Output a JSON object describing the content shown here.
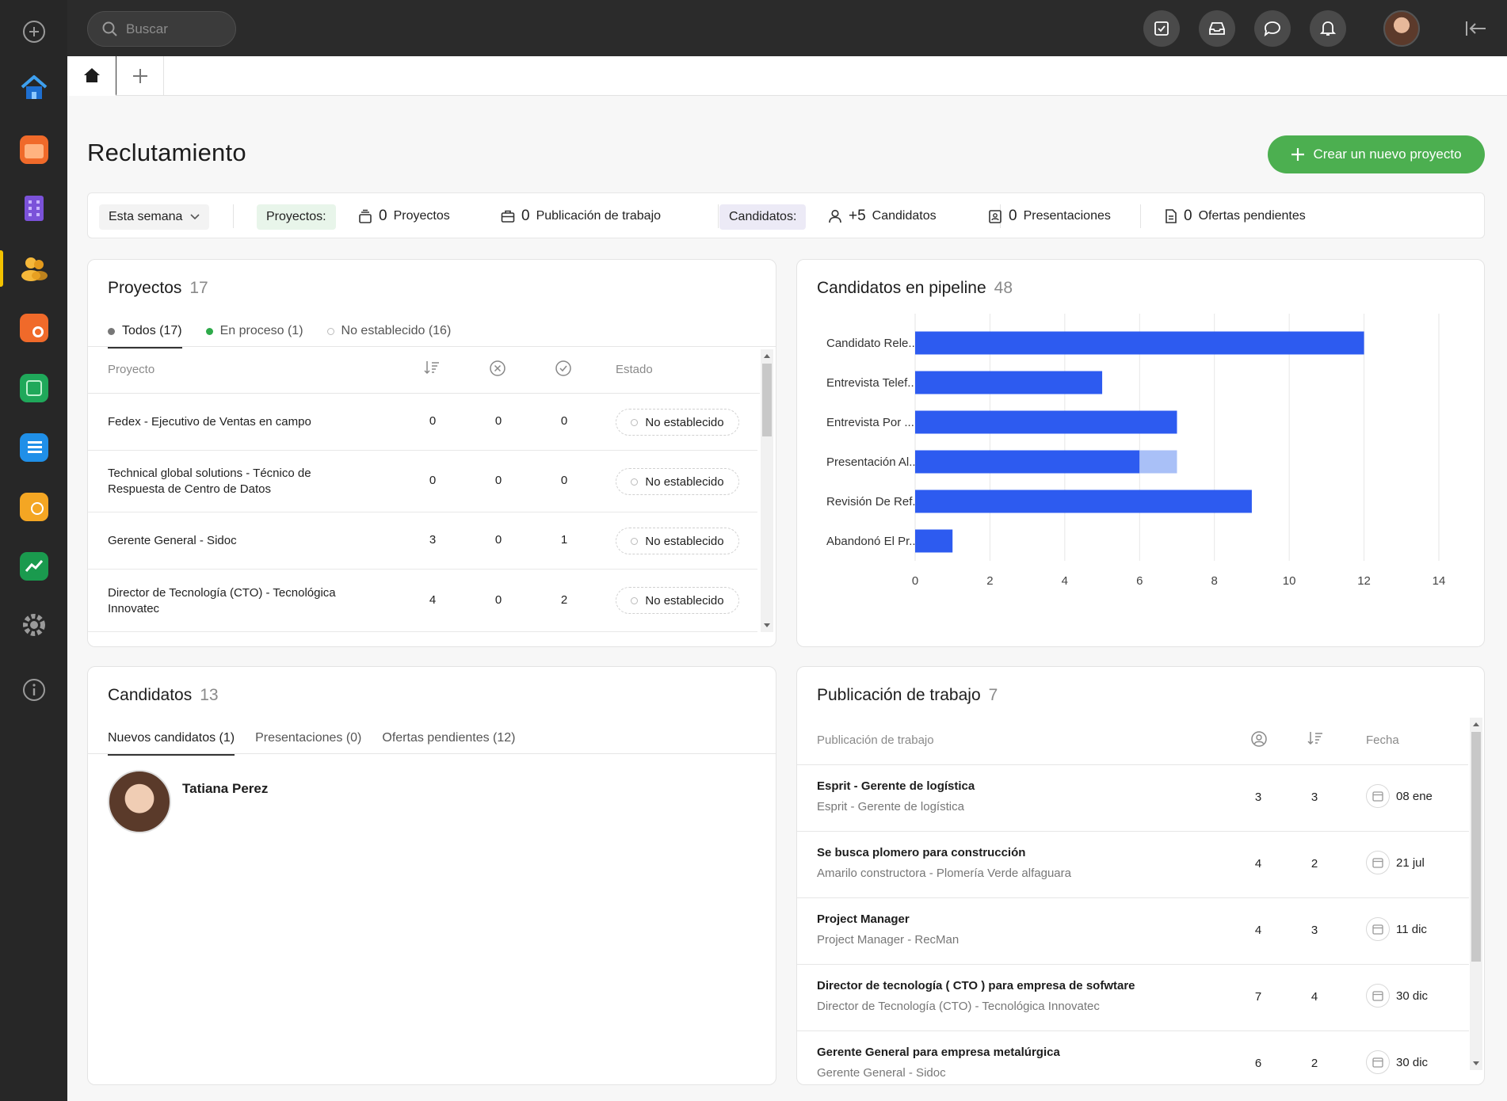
{
  "search": {
    "placeholder": "Buscar"
  },
  "tabs": {
    "home": "home-icon",
    "add": "plus-icon"
  },
  "page": {
    "title": "Reclutamiento",
    "new_project_label": "Crear un nuevo proyecto"
  },
  "filters": {
    "period": "Esta semana",
    "projects_label": "Proyectos:",
    "projects_count": "0",
    "projects_text": "Proyectos",
    "jobposts_count": "0",
    "jobposts_text": "Publicación de trabajo",
    "candidates_label": "Candidatos:",
    "candidates_count": "+5",
    "candidates_text": "Candidatos",
    "presentations_count": "0",
    "presentations_text": "Presentaciones",
    "offers_count": "0",
    "offers_text": "Ofertas pendientes"
  },
  "projects": {
    "title": "Proyectos",
    "count": "17",
    "tabs": [
      {
        "label": "Todos (17)",
        "color": "#777777"
      },
      {
        "label": "En proceso (1)",
        "color": "#2eaa4a"
      },
      {
        "label": "No establecido (16)",
        "color": "#ffffff"
      }
    ],
    "columns": {
      "project": "Proyecto",
      "state": "Estado"
    },
    "rows": [
      {
        "name": "Fedex - Ejecutivo de Ventas en campo",
        "a": "0",
        "b": "0",
        "c": "0",
        "state": "No establecido"
      },
      {
        "name": "Technical global solutions - Técnico de Respuesta de Centro de Datos",
        "a": "0",
        "b": "0",
        "c": "0",
        "state": "No establecido"
      },
      {
        "name": "Gerente General - Sidoc",
        "a": "3",
        "b": "0",
        "c": "1",
        "state": "No establecido"
      },
      {
        "name": "Director de Tecnología (CTO) - Tecnológica Innovatec",
        "a": "4",
        "b": "0",
        "c": "2",
        "state": "No establecido"
      }
    ]
  },
  "pipeline": {
    "title": "Candidatos en pipeline",
    "count": "48"
  },
  "chart_data": {
    "type": "bar",
    "orientation": "horizontal",
    "categories": [
      "Candidato Rele...",
      "Entrevista Telef...",
      "Entrevista Por ...",
      "Presentación Al...",
      "Revisión De Ref...",
      "Abandonó El Pr..."
    ],
    "series": [
      {
        "values": [
          12,
          5,
          7,
          6,
          9,
          1
        ],
        "color": "#2d5bf0"
      },
      {
        "values": [
          0,
          0,
          0,
          1,
          0,
          0
        ],
        "color": "#a9c0f7"
      }
    ],
    "stacked": true,
    "xlim": [
      0,
      14
    ],
    "xticks": [
      0,
      2,
      4,
      6,
      8,
      10,
      12,
      14
    ],
    "grid": true
  },
  "candidates": {
    "title": "Candidatos",
    "count": "13",
    "tabs": [
      "Nuevos candidatos (1)",
      "Presentaciones (0)",
      "Ofertas pendientes (12)"
    ],
    "items": [
      {
        "name": "Tatiana Perez"
      }
    ]
  },
  "jobposts": {
    "title": "Publicación de trabajo",
    "count": "7",
    "columns": {
      "post": "Publicación de trabajo",
      "date": "Fecha"
    },
    "rows": [
      {
        "title": "Esprit - Gerente de logística",
        "sub": "Esprit - Gerente de logística",
        "a": "3",
        "b": "3",
        "date": "08 ene"
      },
      {
        "title": "Se busca plomero para construcción",
        "sub": "Amarilo constructora - Plomería Verde alfaguara",
        "a": "4",
        "b": "2",
        "date": "21 jul"
      },
      {
        "title": "Project Manager",
        "sub": "Project Manager - RecMan",
        "a": "4",
        "b": "3",
        "date": "11 dic"
      },
      {
        "title": "Director de tecnología ( CTO ) para empresa de sofwtare",
        "sub": "Director de Tecnología (CTO) - Tecnológica Innovatec",
        "a": "7",
        "b": "4",
        "date": "30 dic"
      },
      {
        "title": "Gerente General para empresa metalúrgica",
        "sub": "Gerente General - Sidoc",
        "a": "6",
        "b": "2",
        "date": "30 dic"
      }
    ]
  },
  "colors": {
    "accent_green": "#4caf50",
    "rail": "#272727",
    "topbar": "#2b2b2b",
    "bar": "#2d5bf0",
    "bar_light": "#a9c0f7"
  }
}
